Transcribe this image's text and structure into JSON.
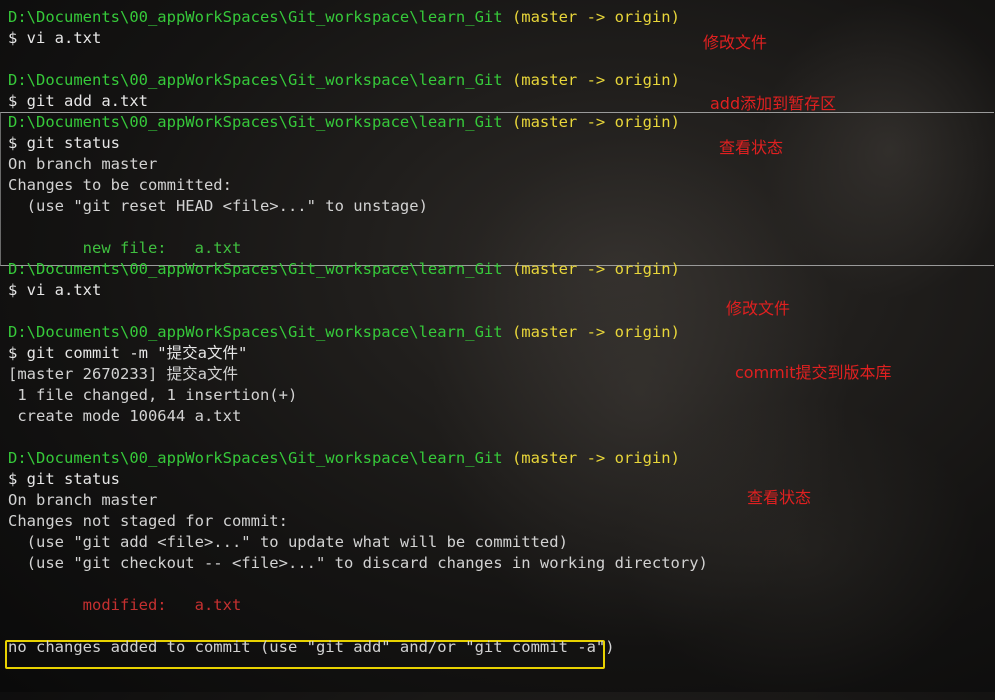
{
  "prompt": {
    "path": "D:\\Documents\\00_appWorkSpaces\\Git_workspace\\learn_Git",
    "branch": "(master -> origin)"
  },
  "lines": [
    {
      "kind": "prompt"
    },
    {
      "kind": "cmd",
      "text": "$ vi a.txt"
    },
    {
      "kind": "blank",
      "text": ""
    },
    {
      "kind": "prompt"
    },
    {
      "kind": "cmd",
      "text": "$ git add a.txt"
    },
    {
      "kind": "prompt"
    },
    {
      "kind": "cmd",
      "text": "$ git status"
    },
    {
      "kind": "out",
      "text": "On branch master"
    },
    {
      "kind": "out",
      "text": "Changes to be committed:"
    },
    {
      "kind": "out",
      "text": "  (use \"git reset HEAD <file>...\" to unstage)"
    },
    {
      "kind": "blank",
      "text": ""
    },
    {
      "kind": "green",
      "text": "        new file:   a.txt"
    },
    {
      "kind": "prompt"
    },
    {
      "kind": "cmd",
      "text": "$ vi a.txt"
    },
    {
      "kind": "blank",
      "text": ""
    },
    {
      "kind": "prompt"
    },
    {
      "kind": "cmd",
      "text": "$ git commit -m \"提交a文件\""
    },
    {
      "kind": "out",
      "text": "[master 2670233] 提交a文件"
    },
    {
      "kind": "out",
      "text": " 1 file changed, 1 insertion(+)"
    },
    {
      "kind": "out",
      "text": " create mode 100644 a.txt"
    },
    {
      "kind": "blank",
      "text": ""
    },
    {
      "kind": "prompt"
    },
    {
      "kind": "cmd",
      "text": "$ git status"
    },
    {
      "kind": "out",
      "text": "On branch master"
    },
    {
      "kind": "out",
      "text": "Changes not staged for commit:"
    },
    {
      "kind": "out",
      "text": "  (use \"git add <file>...\" to update what will be committed)"
    },
    {
      "kind": "out",
      "text": "  (use \"git checkout -- <file>...\" to discard changes in working directory)"
    },
    {
      "kind": "blank",
      "text": ""
    },
    {
      "kind": "red",
      "text": "        modified:   a.txt"
    },
    {
      "kind": "blank",
      "text": ""
    },
    {
      "kind": "out",
      "text": "no changes added to commit (use \"git add\" and/or \"git commit -a\")"
    }
  ],
  "annotations": {
    "modify_file_1": "修改文件",
    "add_to_stage": "add添加到暂存区",
    "check_status_1": "查看状态",
    "modify_file_2": "修改文件",
    "commit_to_repo": "commit提交到版本库",
    "check_status_2": "查看状态"
  },
  "colors": {
    "path": "#36c93a",
    "branch": "#e8d63a",
    "annotation": "#e02020",
    "highlight_border": "#e8d200",
    "staged": "#3fbf3f",
    "modified": "#c53030"
  }
}
